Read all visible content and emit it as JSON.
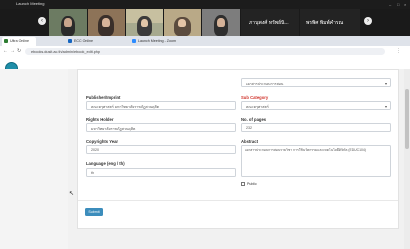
{
  "zoom": {
    "window_title": "Launch Meeting",
    "participants": [
      {
        "name": "",
        "tile": "tile-1"
      },
      {
        "name": "",
        "tile": "tile-2"
      },
      {
        "name": "",
        "tile": "tile-3"
      },
      {
        "name": "",
        "tile": "tile-4"
      },
      {
        "name": "",
        "tile": "tile-5"
      },
      {
        "name": "ภานุพงศ์ ทรัพย์นิ...",
        "tile": "tile-6"
      },
      {
        "name": "พรพิศ พิมพ์คำรณ",
        "tile": "tile-7"
      }
    ]
  },
  "browser": {
    "tabs": [
      {
        "label": "Ultra Online"
      },
      {
        "label": "ECC Online"
      },
      {
        "label": "Launch Meeting - Zoom"
      }
    ],
    "url": "ebooks.dusit.ac.th/admin/ebook_edit.php"
  },
  "site": {
    "logo_title": "",
    "logo_subtitle": ""
  },
  "form": {
    "top_select_value": "เอกสารประกอบการสอน",
    "publisher_label": "Publisher/Imprint",
    "publisher_value": "คณะครุศาสตร์ มหาวิทยาลัยราชภัฏสวนดุสิต",
    "subcategory_label": "Sub Category",
    "subcategory_value": "คณะครุศาสตร์",
    "rights_label": "Rights Holder",
    "rights_value": "มหาวิทยาลัยราชภัฏสวนดุสิต",
    "pages_label": "No. of pages",
    "pages_value": "232",
    "copyright_label": "Copyrights Year",
    "copyright_value": "2020",
    "abstract_label": "Abstract",
    "abstract_value": "เอกสารประกอบการสอนรายวิชา การใช้นวัตกรรมและเทคโนโลยีดิจิทัล (EDUC104)",
    "language_label": "Language (eng / th)",
    "language_value": "th",
    "checkbox_label": "Public",
    "submit_label": "Submit"
  }
}
